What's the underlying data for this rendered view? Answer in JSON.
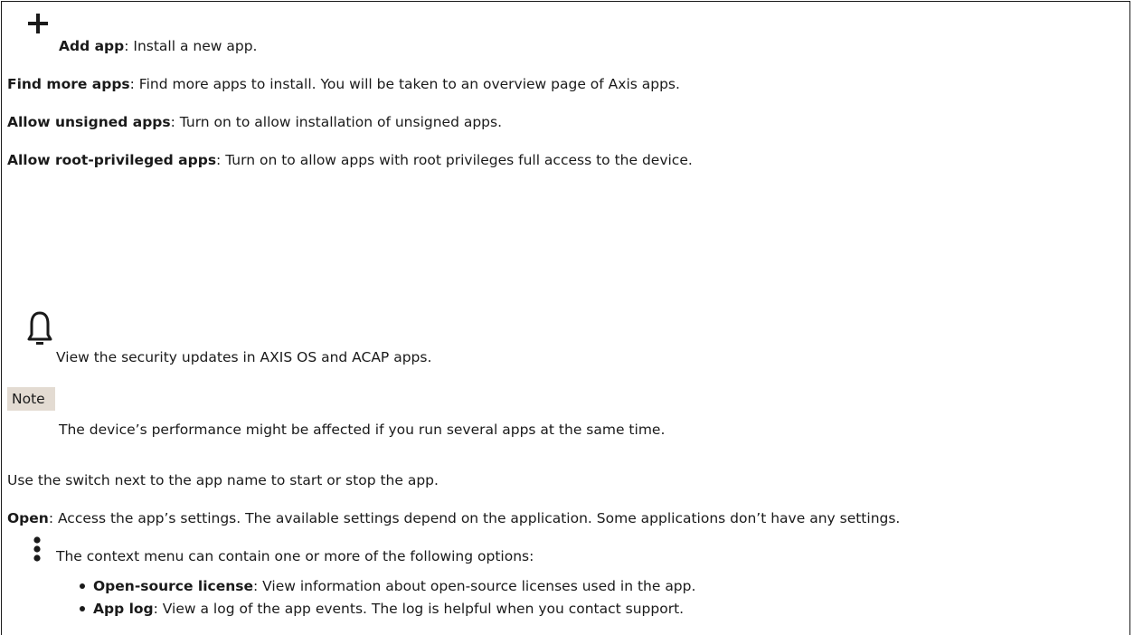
{
  "add_app": {
    "icon": "plus-icon",
    "term": "Add app",
    "desc": ": Install a new app."
  },
  "find_more_apps": {
    "term": "Find more apps",
    "desc": ": Find more apps to install. You will be taken to an overview page of Axis apps."
  },
  "allow_unsigned": {
    "term": "Allow unsigned apps",
    "desc": ": Turn on to allow installation of unsigned apps."
  },
  "allow_root": {
    "term": "Allow root-privileged apps",
    "desc": ": Turn on to allow apps with root privileges full access to the device."
  },
  "security_updates": {
    "icon": "bell-icon",
    "text": "View the security updates in AXIS OS and ACAP apps."
  },
  "note": {
    "label": "Note",
    "text": "The device’s performance might be affected if you run several apps at the same time."
  },
  "switch_text": "Use the switch next to the app name to start or stop the app.",
  "open": {
    "term": "Open",
    "desc": ": Access the app’s settings. The available settings depend on the application. Some applications don’t have any settings."
  },
  "context_menu": {
    "icon": "vertical-ellipsis-icon",
    "intro": "The context menu can contain one or more of the following options:",
    "items": [
      {
        "term": "Open-source license",
        "desc": ": View information about open-source licenses used in the app."
      },
      {
        "term": "App log",
        "desc": ": View a log of the app events. The log is helpful when you contact support."
      }
    ]
  }
}
